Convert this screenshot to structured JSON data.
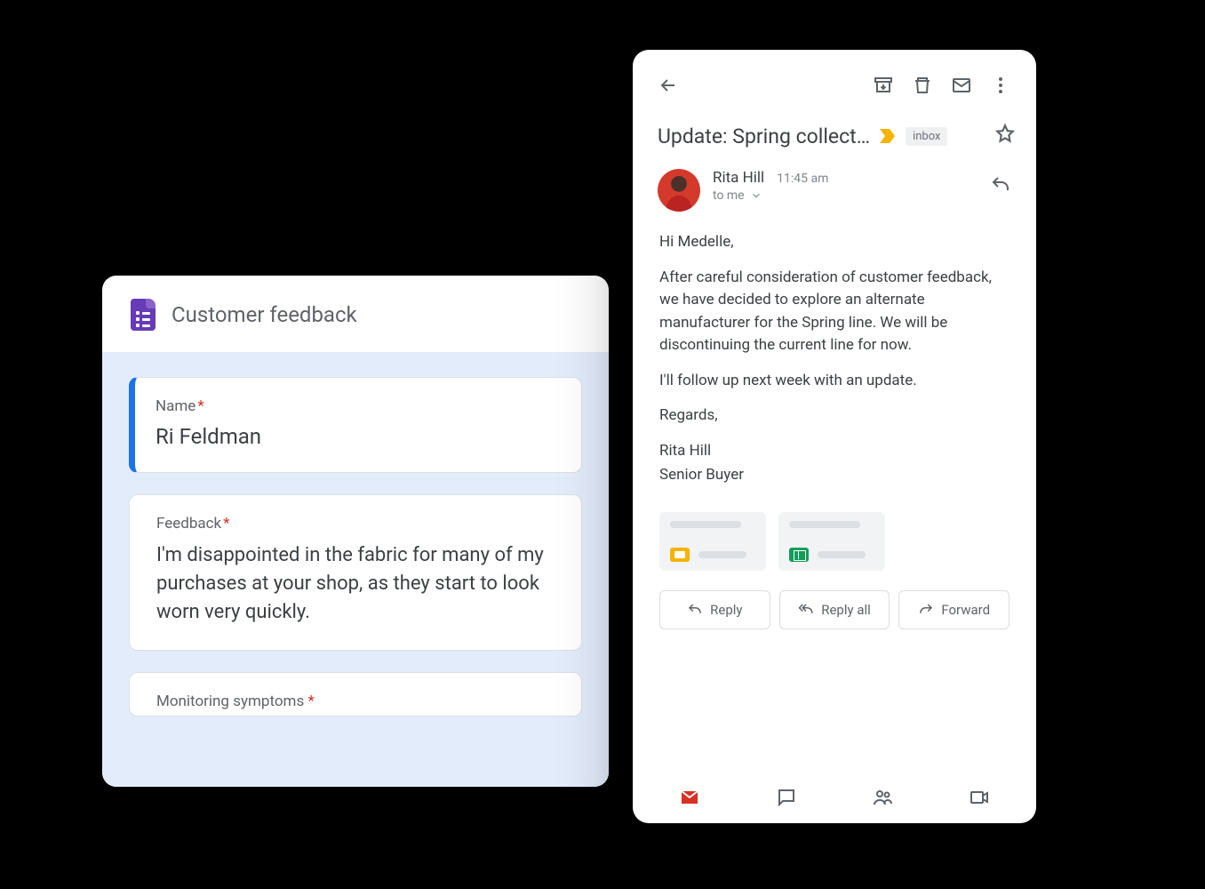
{
  "forms": {
    "title": "Customer feedback",
    "questions": [
      {
        "label": "Name",
        "required": true,
        "value": "Ri Feldman"
      },
      {
        "label": "Feedback",
        "required": true,
        "value": "I'm disappointed in the fabric for many of my purchases at your shop, as they start to look worn very quickly."
      },
      {
        "label": "Monitoring symptoms",
        "required": true,
        "value": ""
      }
    ]
  },
  "gmail": {
    "subject": "Update: Spring collect…",
    "inbox_chip": "inbox",
    "sender": {
      "name": "Rita Hill",
      "time": "11:45 am",
      "to": "to me"
    },
    "body": {
      "greeting": "Hi Medelle,",
      "p1": "After careful consideration of customer feedback, we have decided to explore an alternate manufacturer for the Spring line. We will be discontinuing the current line for now.",
      "p2": "I'll follow up next week with an update.",
      "closing": "Regards,",
      "sig1": "Rita Hill",
      "sig2": "Senior Buyer"
    },
    "actions": {
      "reply": "Reply",
      "reply_all": "Reply all",
      "forward": "Forward"
    }
  }
}
